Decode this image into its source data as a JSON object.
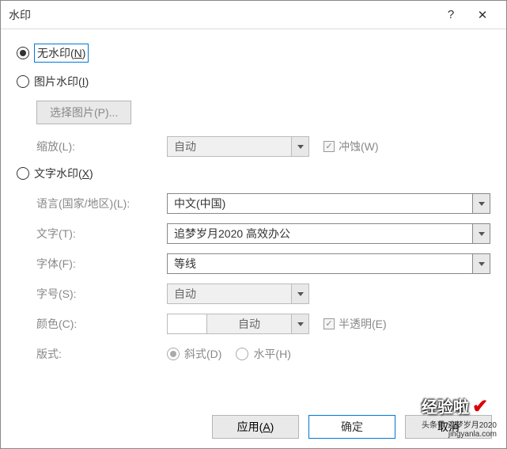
{
  "titlebar": {
    "title": "水印",
    "help": "?",
    "close": "✕"
  },
  "options": {
    "none": "无水印(N)",
    "picture": "图片水印(I)",
    "text": "文字水印(X)"
  },
  "picture": {
    "selectBtn": "选择图片(P)...",
    "scaleLabel": "缩放(L):",
    "scaleValue": "自动",
    "washoutLabel": "冲蚀(W)"
  },
  "textwm": {
    "langLabel": "语言(国家/地区)(L):",
    "langValue": "中文(中国)",
    "textLabel": "文字(T):",
    "textValue": "追梦岁月2020  高效办公",
    "fontLabel": "字体(F):",
    "fontValue": "等线",
    "sizeLabel": "字号(S):",
    "sizeValue": "自动",
    "colorLabel": "颜色(C):",
    "colorValue": "自动",
    "semiLabel": "半透明(E)",
    "layoutLabel": "版式:",
    "diagonal": "斜式(D)",
    "horizontal": "水平(H)"
  },
  "footer": {
    "apply": "应用(A)",
    "ok": "确定",
    "cancel": "取消"
  },
  "logo": {
    "text": "经验啦",
    "sub": "jingyanla.com",
    "subtext": "头条号 追梦岁月2020"
  }
}
